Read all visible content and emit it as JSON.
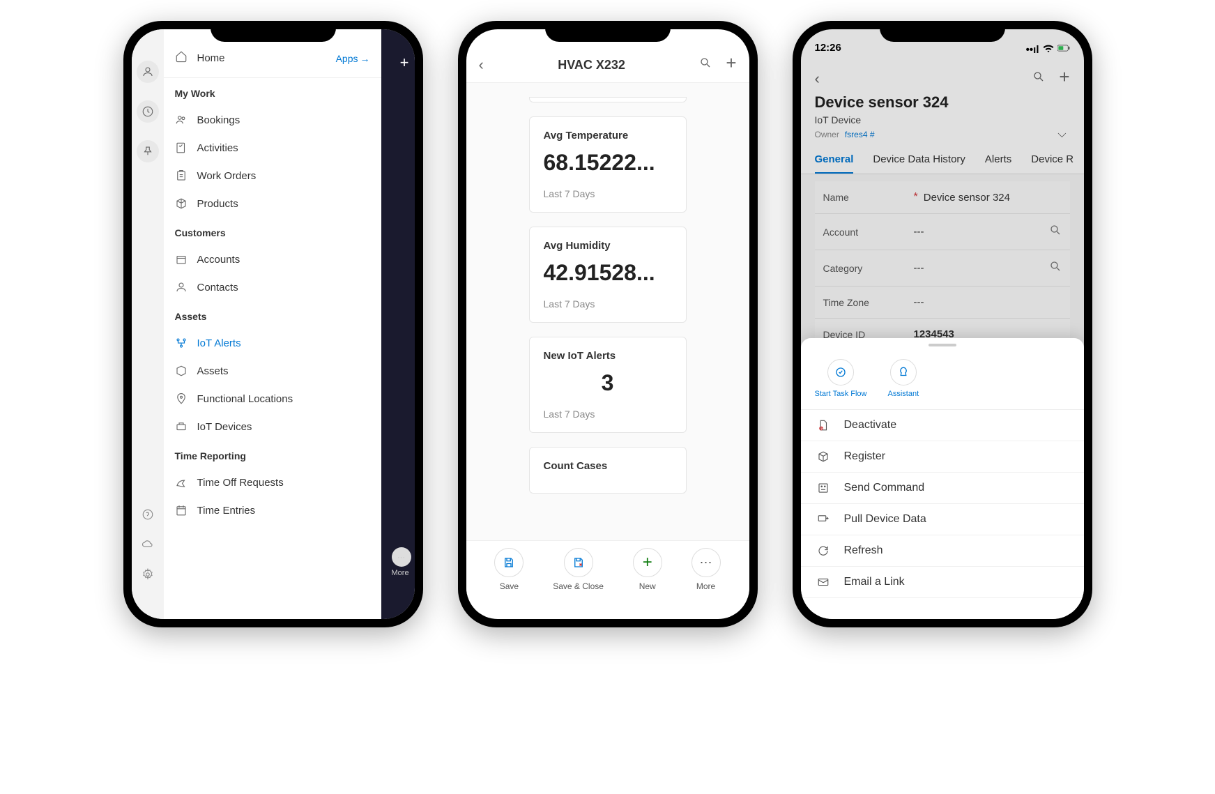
{
  "phone1": {
    "home": "Home",
    "apps": "Apps",
    "sections": {
      "mywork": "My Work",
      "customers": "Customers",
      "assets": "Assets",
      "timereporting": "Time Reporting"
    },
    "items": {
      "bookings": "Bookings",
      "activities": "Activities",
      "workorders": "Work Orders",
      "products": "Products",
      "accounts": "Accounts",
      "contacts": "Contacts",
      "iotalerts": "IoT Alerts",
      "assets_item": "Assets",
      "functional": "Functional Locations",
      "iotdevices": "IoT Devices",
      "timeoff": "Time Off Requests",
      "timeentries": "Time Entries"
    },
    "overlay_more": "More"
  },
  "phone2": {
    "title": "HVAC X232",
    "cards": [
      {
        "title": "Avg Temperature",
        "value": "68.15222...",
        "sub": "Last 7 Days"
      },
      {
        "title": "Avg Humidity",
        "value": "42.91528...",
        "sub": "Last 7 Days"
      },
      {
        "title": "New IoT Alerts",
        "value": "3",
        "sub": "Last 7 Days"
      },
      {
        "title": "Count Cases",
        "value": "",
        "sub": ""
      }
    ],
    "buttons": {
      "save": "Save",
      "saveclose": "Save & Close",
      "new": "New",
      "more": "More"
    }
  },
  "phone3": {
    "status_time": "12:26",
    "title": "Device sensor 324",
    "subtitle": "IoT Device",
    "owner_label": "Owner",
    "owner_value": "fsres4 #",
    "tabs": [
      "General",
      "Device Data History",
      "Alerts",
      "Device R"
    ],
    "fields": [
      {
        "label": "Name",
        "required": true,
        "value": "Device sensor 324",
        "lookup": false
      },
      {
        "label": "Account",
        "required": false,
        "value": "---",
        "lookup": true
      },
      {
        "label": "Category",
        "required": false,
        "value": "---",
        "lookup": true
      },
      {
        "label": "Time Zone",
        "required": false,
        "value": "---",
        "lookup": false
      },
      {
        "label": "Device ID",
        "required": false,
        "value": "1234543",
        "lookup": false
      }
    ],
    "sheet_top": {
      "taskflow": "Start Task Flow",
      "assistant": "Assistant"
    },
    "sheet_items": [
      "Deactivate",
      "Register",
      "Send Command",
      "Pull Device Data",
      "Refresh",
      "Email a Link"
    ]
  }
}
